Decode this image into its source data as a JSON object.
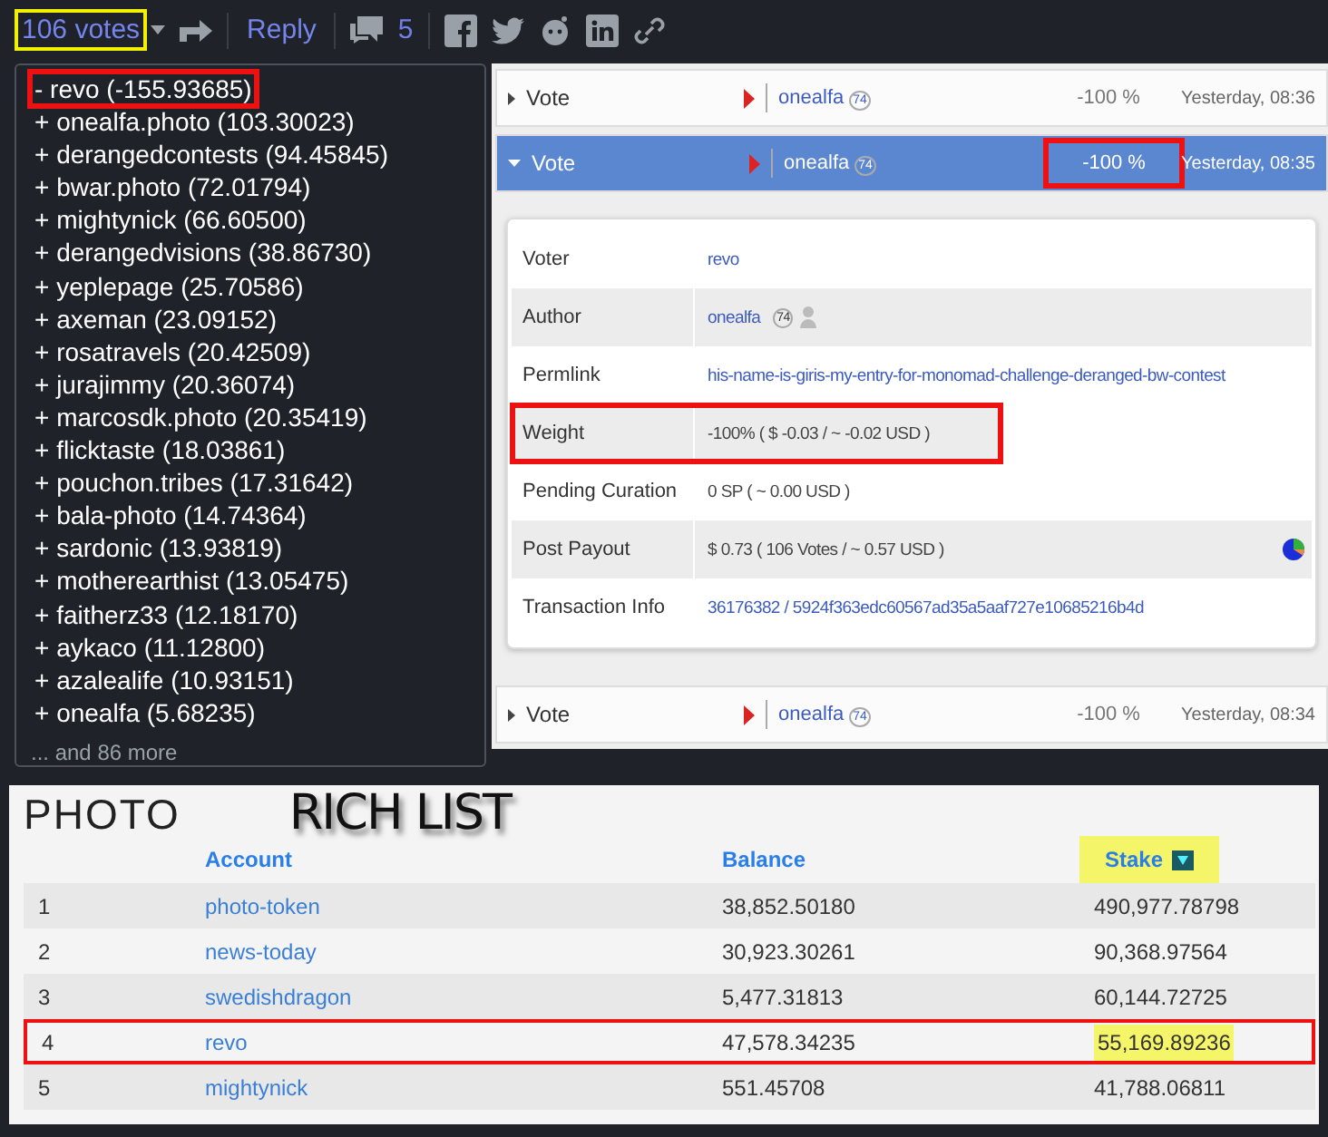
{
  "toolbar": {
    "votes": "106 votes",
    "votes_highlighted": true,
    "reply": "Reply",
    "comments": "5"
  },
  "voters": {
    "items": [
      {
        "text": "- revo (-155.93685)",
        "highlighted": true
      },
      {
        "text": "+ onealfa.photo (103.30023)",
        "highlighted": false
      },
      {
        "text": "+ derangedcontests (94.45845)",
        "highlighted": false
      },
      {
        "text": "+ bwar.photo (72.01794)",
        "highlighted": false
      },
      {
        "text": "+ mightynick (66.60500)",
        "highlighted": false
      },
      {
        "text": "+ derangedvisions (38.86730)",
        "highlighted": false
      },
      {
        "text": "+ yeplepage (25.70586)",
        "highlighted": false
      },
      {
        "text": "+ axeman (23.09152)",
        "highlighted": false
      },
      {
        "text": "+ rosatravels (20.42509)",
        "highlighted": false
      },
      {
        "text": "+ jurajimmy (20.36074)",
        "highlighted": false
      },
      {
        "text": "+ marcosdk.photo (20.35419)",
        "highlighted": false
      },
      {
        "text": "+ flicktaste (18.03861)",
        "highlighted": false
      },
      {
        "text": "+ pouchon.tribes (17.31642)",
        "highlighted": false
      },
      {
        "text": "+ bala-photo (14.74364)",
        "highlighted": false
      },
      {
        "text": "+ sardonic (13.93819)",
        "highlighted": false
      },
      {
        "text": "+ motherearthist (13.05475)",
        "highlighted": false
      },
      {
        "text": "+ faitherz33 (12.18170)",
        "highlighted": false
      },
      {
        "text": "+ aykaco (11.12800)",
        "highlighted": false
      },
      {
        "text": "+ azalealife (10.93151)",
        "highlighted": false
      },
      {
        "text": "+ onealfa (5.68235)",
        "highlighted": false
      }
    ],
    "more": "... and 86 more"
  },
  "operations": [
    {
      "label": "Vote",
      "author": "onealfa",
      "reputation": "74",
      "percent": "-100 %",
      "percent_highlighted": false,
      "time": "Yesterday, 08:36",
      "expanded": false
    },
    {
      "label": "Vote",
      "author": "onealfa",
      "reputation": "74",
      "percent": "-100 %",
      "percent_highlighted": true,
      "time": "Yesterday, 08:35",
      "expanded": true,
      "details": [
        {
          "label": "Voter",
          "value": "revo",
          "kind": "link",
          "highlighted": false
        },
        {
          "label": "Author",
          "value": "onealfa",
          "reputation": "74",
          "kind": "author",
          "highlighted": false
        },
        {
          "label": "Permlink",
          "value": "his-name-is-giris-my-entry-for-monomad-challenge-deranged-bw-contest",
          "kind": "link",
          "highlighted": false
        },
        {
          "label": "Weight",
          "value": "-100% ( $ -0.03 / ~ -0.02 USD )",
          "kind": "text",
          "highlighted": true
        },
        {
          "label": "Pending Curation",
          "value": "0 SP ( ~ 0.00 USD )",
          "kind": "text",
          "highlighted": false
        },
        {
          "label": "Post Payout",
          "value": "$ 0.73 ( 106 Votes / ~ 0.57 USD )",
          "kind": "payout",
          "highlighted": false
        },
        {
          "label": "Transaction Info",
          "value": "36176382 / 5924f363edc60567ad35a5aaf727e10685216b4d",
          "kind": "link",
          "highlighted": false
        }
      ]
    },
    {
      "label": "Vote",
      "author": "onealfa",
      "reputation": "74",
      "percent": "-100 %",
      "percent_highlighted": false,
      "time": "Yesterday, 08:34",
      "expanded": false
    }
  ],
  "rich_list": {
    "token": "PHOTO",
    "title": "RICH LIST",
    "columns": [
      {
        "label": "Account",
        "sorted": false,
        "highlighted": false
      },
      {
        "label": "Balance",
        "sorted": false,
        "highlighted": false
      },
      {
        "label": "Stake",
        "sorted": true,
        "highlighted": true
      }
    ],
    "rows": [
      {
        "rank": "1",
        "account": "photo-token",
        "balance": "38,852.50180",
        "stake": "490,977.78798",
        "highlighted": false
      },
      {
        "rank": "2",
        "account": "news-today",
        "balance": "30,923.30261",
        "stake": "90,368.97564",
        "highlighted": false
      },
      {
        "rank": "3",
        "account": "swedishdragon",
        "balance": "5,477.31813",
        "stake": "60,144.72725",
        "highlighted": false
      },
      {
        "rank": "4",
        "account": "revo",
        "balance": "47,578.34235",
        "stake": "55,169.89236",
        "highlighted": true
      },
      {
        "rank": "5",
        "account": "mightynick",
        "balance": "551.45708",
        "stake": "41,788.06811",
        "highlighted": false
      }
    ]
  }
}
